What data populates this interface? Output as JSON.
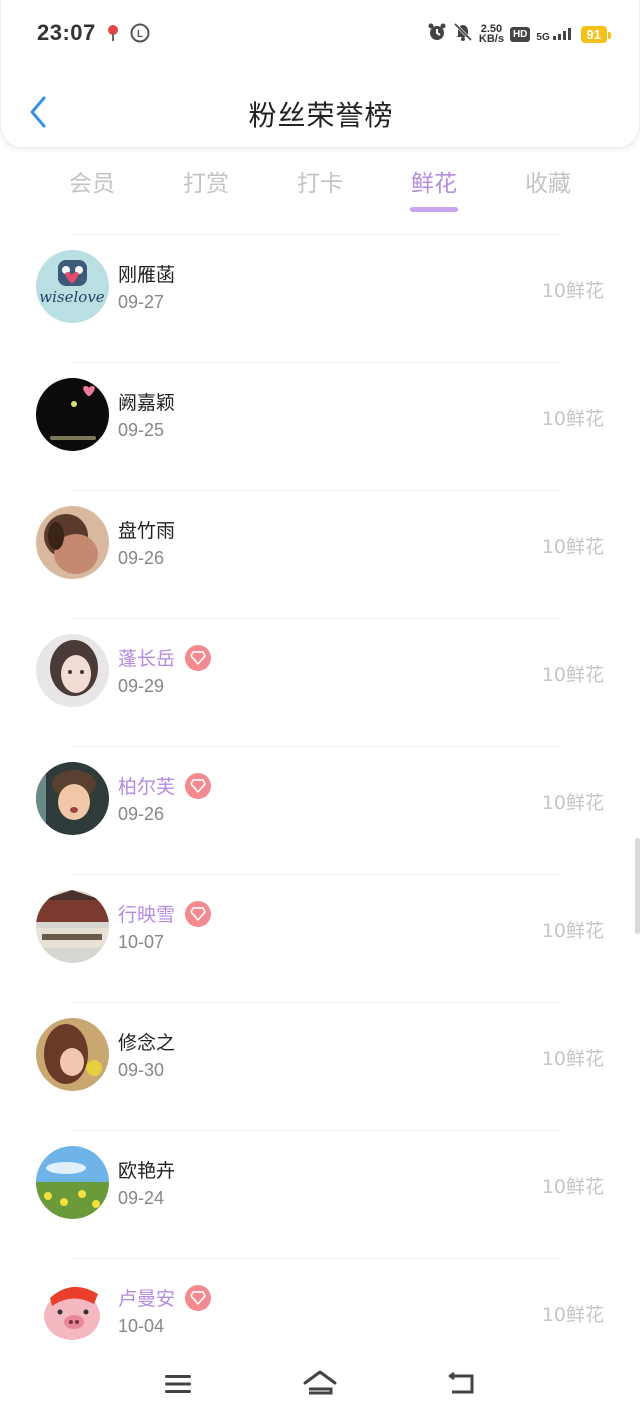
{
  "status_bar": {
    "time": "23:07",
    "speed_value": "2.50",
    "speed_unit": "KB/s",
    "hd": "HD",
    "network": "5G",
    "battery": "91"
  },
  "header": {
    "title": "粉丝荣誉榜",
    "back_icon": "chevron-left-icon"
  },
  "tabs": [
    {
      "label": "会员",
      "active": false
    },
    {
      "label": "打赏",
      "active": false
    },
    {
      "label": "打卡",
      "active": false
    },
    {
      "label": "鲜花",
      "active": true
    },
    {
      "label": "收藏",
      "active": false
    }
  ],
  "fans": [
    {
      "name": "刚雁菡",
      "date": "09-27",
      "amount": "10鲜花",
      "vip": false
    },
    {
      "name": "阙嘉颖",
      "date": "09-25",
      "amount": "10鲜花",
      "vip": false
    },
    {
      "name": "盘竹雨",
      "date": "09-26",
      "amount": "10鲜花",
      "vip": false
    },
    {
      "name": "蓬长岳",
      "date": "09-29",
      "amount": "10鲜花",
      "vip": true
    },
    {
      "name": "柏尔芙",
      "date": "09-26",
      "amount": "10鲜花",
      "vip": true
    },
    {
      "name": "行映雪",
      "date": "10-07",
      "amount": "10鲜花",
      "vip": true
    },
    {
      "name": "修念之",
      "date": "09-30",
      "amount": "10鲜花",
      "vip": false
    },
    {
      "name": "欧艳卉",
      "date": "09-24",
      "amount": "10鲜花",
      "vip": false
    },
    {
      "name": "卢曼安",
      "date": "10-04",
      "amount": "10鲜花",
      "vip": true
    }
  ],
  "avatar_texts": {
    "wiselove": "wiselove"
  },
  "colors": {
    "accent": "#b58be0",
    "vip_badge": "#f28b8f",
    "battery": "#f4c21a"
  },
  "nav": {
    "menu_icon": "menu-icon",
    "home_icon": "home-icon",
    "back_icon": "back-icon"
  }
}
